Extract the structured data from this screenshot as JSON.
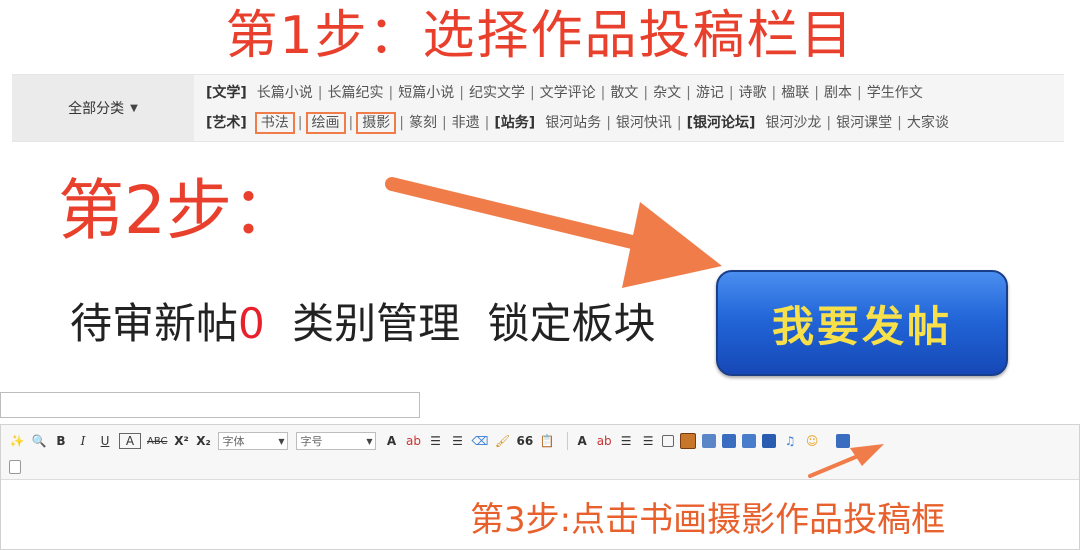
{
  "step1": {
    "title": "第1步：选择作品投稿栏目"
  },
  "category_bar": {
    "all_label": "全部分类",
    "row1": {
      "group": "[文学]",
      "items": [
        "长篇小说",
        "长篇纪实",
        "短篇小说",
        "纪实文学",
        "文学评论",
        "散文",
        "杂文",
        "游记",
        "诗歌",
        "楹联",
        "剧本",
        "学生作文"
      ]
    },
    "row2": {
      "group": "[艺术]",
      "items_a": [
        "书法",
        "绘画",
        "摄影",
        "篆刻",
        "非遗"
      ],
      "group2": "[站务]",
      "items_b": [
        "银河站务",
        "银河快讯"
      ],
      "group3": "[银河论坛]",
      "items_c": [
        "银河沙龙",
        "银河课堂",
        "大家谈"
      ]
    }
  },
  "step2": {
    "title": "第2步："
  },
  "forum_toolbar": {
    "pending_label": "待审新帖",
    "pending_count": "0",
    "category_manage": "类别管理",
    "lock_board": "锁定板块",
    "post_button": "我要发帖"
  },
  "editor": {
    "bold": "B",
    "italic": "I",
    "underline": "U",
    "boxed": "A",
    "strike": "ABC",
    "superscript": "X²",
    "subscript": "X₂",
    "font_select": "字体",
    "size_select": "字号",
    "font_color": "A",
    "quote": "66",
    "accent_arrow": "#f07c4a"
  },
  "step3": {
    "title": "第3步:点击书画摄影作品投稿框"
  },
  "colors": {
    "step_red": "#e8402c",
    "button_blue": "#2266d8",
    "button_text": "#f7e04a",
    "highlight": "#f07c4a"
  }
}
